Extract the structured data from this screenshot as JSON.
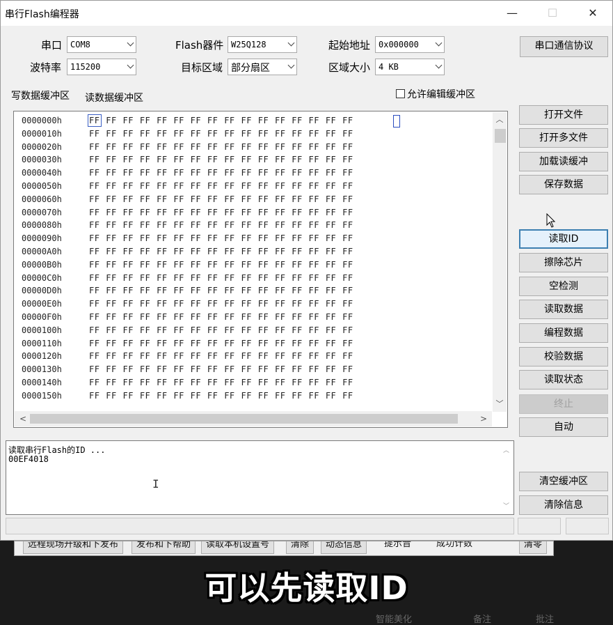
{
  "window": {
    "title": "串行Flash编程器",
    "controls": {
      "minimize": "—",
      "maximize": "☐",
      "close": "✕"
    }
  },
  "settings": {
    "port_label": "串口",
    "port_value": "COM8",
    "baud_label": "波特率",
    "baud_value": "115200",
    "device_label": "Flash器件",
    "device_value": "W25Q128",
    "target_label": "目标区域",
    "target_value": "部分扇区",
    "start_addr_label": "起始地址",
    "start_addr_value": "0x000000",
    "size_label": "区域大小",
    "size_value": "4 KB",
    "protocol_button": "串口通信协议"
  },
  "tabs": {
    "write_buffer": "写数据缓冲区",
    "read_buffer": "读数据缓冲区",
    "allow_edit": "允许编辑缓冲区"
  },
  "hex": {
    "bytes": "FF FF FF FF FF FF FF FF FF FF FF FF FF FF FF FF",
    "addresses": [
      "0000000h",
      "0000010h",
      "0000020h",
      "0000030h",
      "0000040h",
      "0000050h",
      "0000060h",
      "0000070h",
      "0000080h",
      "0000090h",
      "00000A0h",
      "00000B0h",
      "00000C0h",
      "00000D0h",
      "00000E0h",
      "00000F0h",
      "0000100h",
      "0000110h",
      "0000120h",
      "0000130h",
      "0000140h",
      "0000150h"
    ]
  },
  "buttons": {
    "open_file": "打开文件",
    "open_multi": "打开多文件",
    "load_read": "加载读缓冲",
    "save_data": "保存数据",
    "read_id": "读取ID",
    "erase_chip": "擦除芯片",
    "blank_check": "空检测",
    "read_data": "读取数据",
    "program_data": "编程数据",
    "verify_data": "校验数据",
    "read_status": "读取状态",
    "stop": "终止",
    "auto": "自动",
    "clear_buffer": "清空缓冲区",
    "clear_info": "清除信息"
  },
  "info": {
    "line1": "读取串行Flash的ID ...",
    "line2": "00EF4018"
  },
  "behind": {
    "item1": "远程现场升级和下发布",
    "item2": "发布和下帮助",
    "item3": "读取本机设置号",
    "item4": "清除",
    "item5": "动态信息",
    "item6": "提示音",
    "item7": "成功计数",
    "item8": "清零"
  },
  "caption": "可以先读取ID",
  "bottom": {
    "item1": "智能美化",
    "item2": "备注",
    "item3": "批注"
  }
}
